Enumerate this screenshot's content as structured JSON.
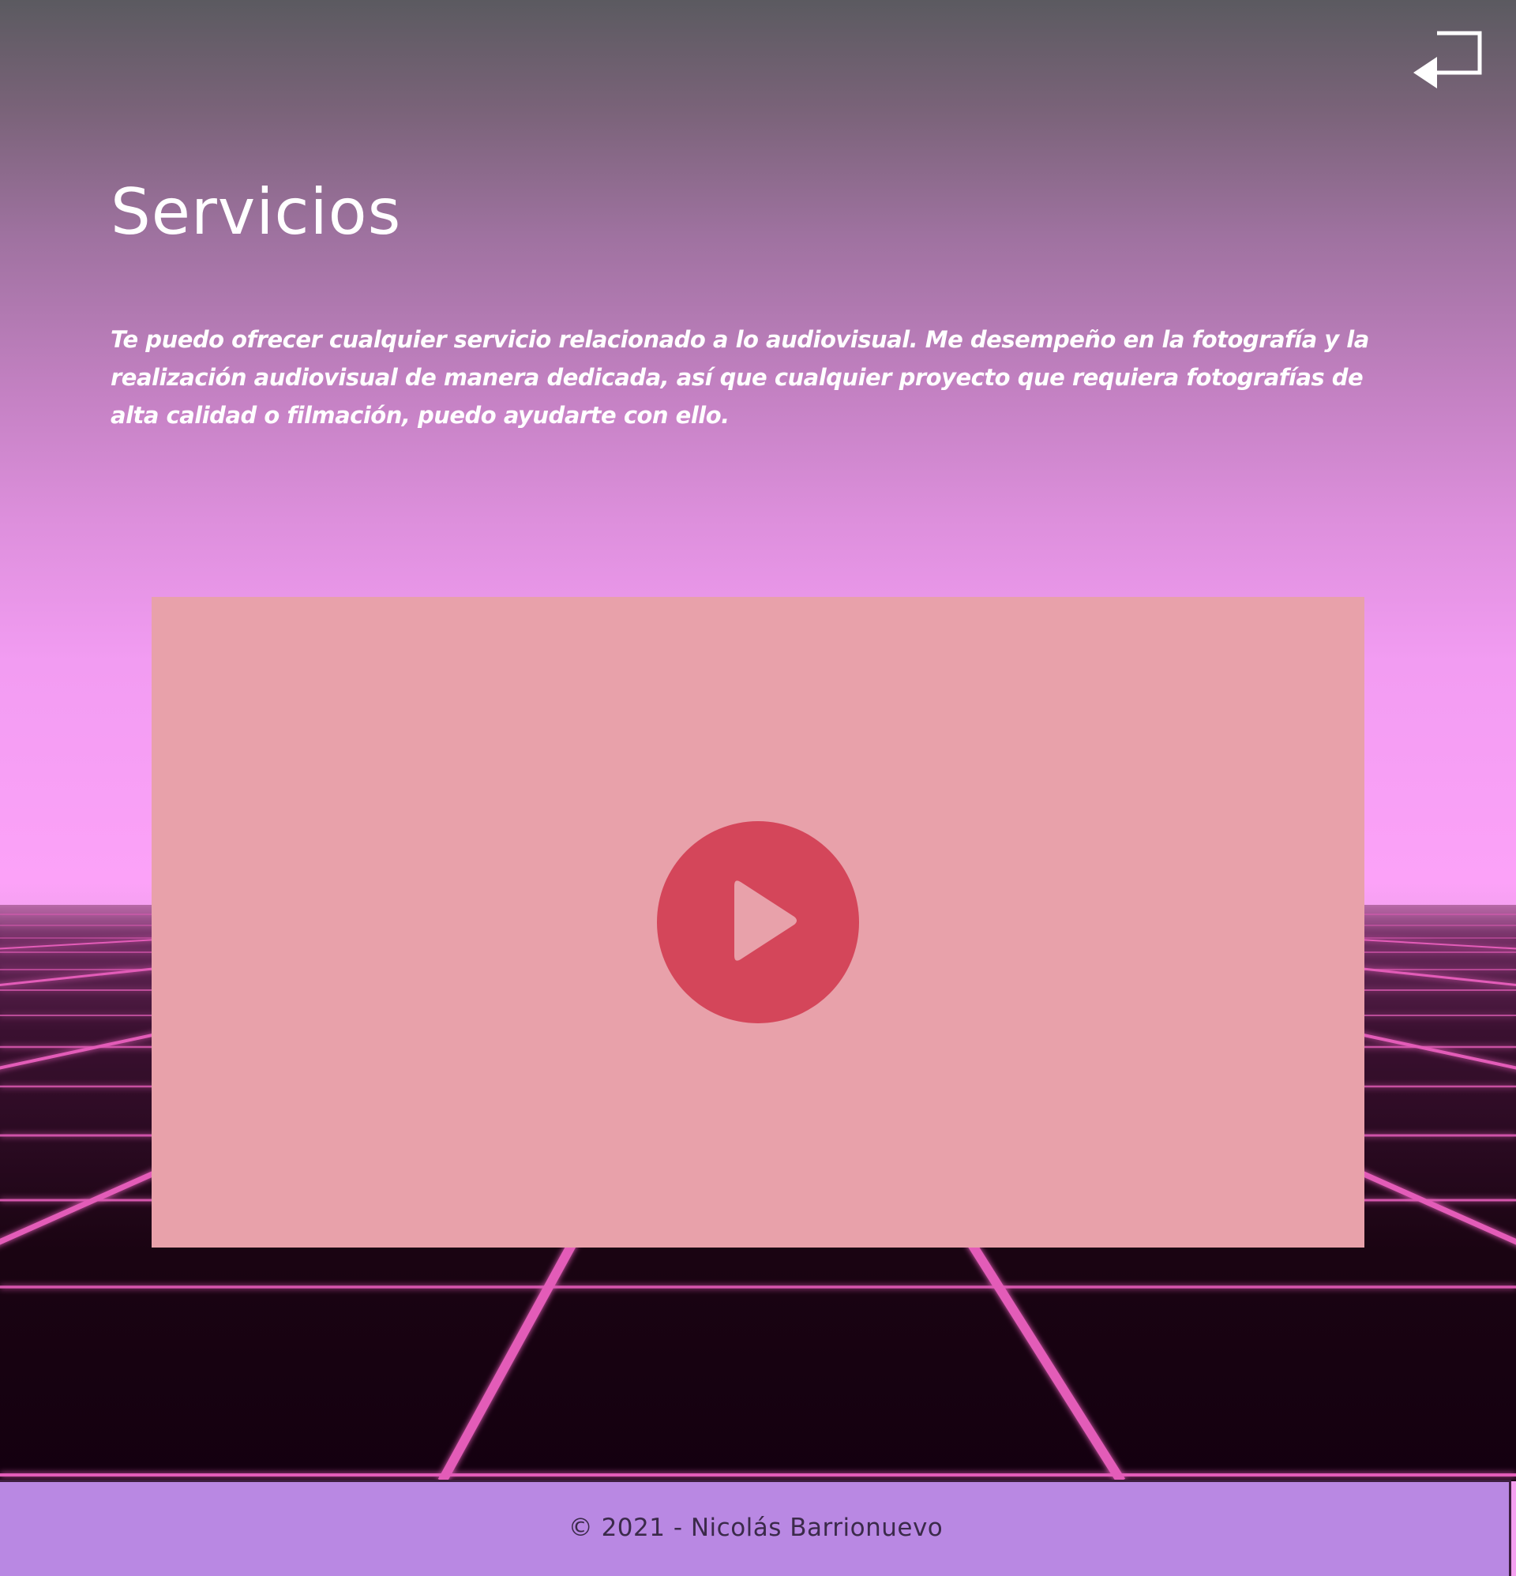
{
  "header": {
    "back_icon": "return-arrow-icon"
  },
  "main": {
    "title": "Servicios",
    "intro": "Te puedo ofrecer cualquier servicio relacionado a lo audiovisual. Me desempeño en la fotografía y la realización audiovisual de manera dedicada, así que cualquier proyecto que requiera fotografías de alta calidad o filmación, puedo ayudarte con ello."
  },
  "video": {
    "play_icon": "play-icon",
    "background_color": "#e8a1aa",
    "button_color": "#d4465a"
  },
  "footer": {
    "text": "© 2021 - Nicolás Barrionuevo"
  },
  "colors": {
    "grid_line": "#e35cb8",
    "footer_bg": "#b988e3"
  }
}
